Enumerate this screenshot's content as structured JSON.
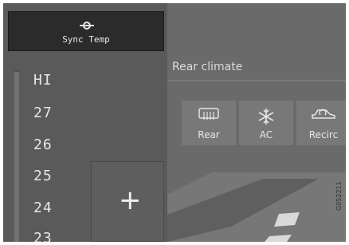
{
  "sync_temp": {
    "label": "Sync Temp"
  },
  "temperature_scale": [
    "HI",
    "27",
    "26",
    "25",
    "24",
    "23"
  ],
  "plus_button": {
    "label": "+"
  },
  "rear_climate": {
    "title": "Rear climate"
  },
  "controls": [
    {
      "label": "Rear",
      "icon": "rear-defrost-icon"
    },
    {
      "label": "AC",
      "icon": "ac-snowflake-icon"
    },
    {
      "label": "Recirc",
      "icon": "recirculation-icon"
    }
  ],
  "image_code": "G052211"
}
